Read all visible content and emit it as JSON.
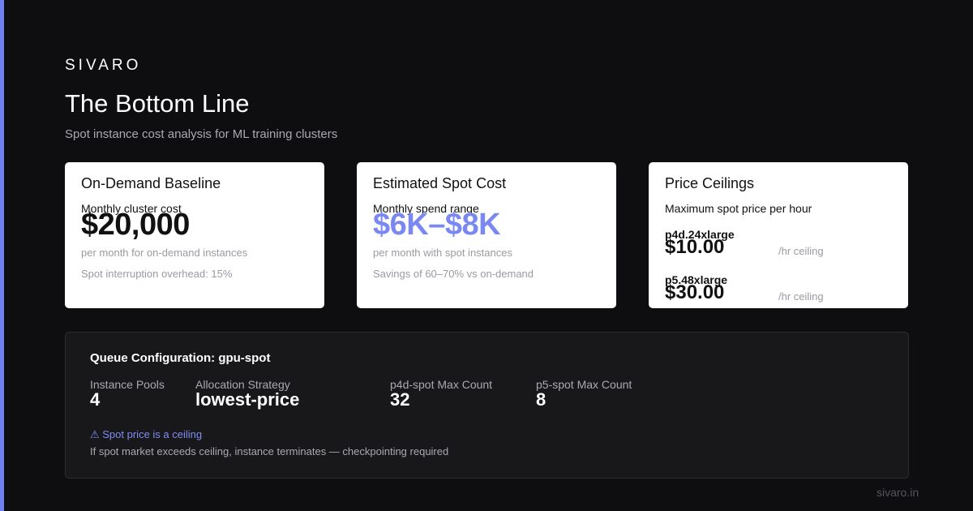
{
  "brand": "SIVARO",
  "header": {
    "title": "The Bottom Line",
    "subtitle": "Spot instance cost analysis for ML training clusters"
  },
  "cards": {
    "on_demand": {
      "title": "On-Demand Baseline",
      "label": "Monthly cluster cost",
      "value": "$20,000",
      "note": "per month for on-demand instances",
      "note2": "Spot interruption overhead: 15%"
    },
    "spot": {
      "title": "Estimated Spot Cost",
      "label": "Monthly spend range",
      "value": "$6K–$8K",
      "note": "per month with spot instances",
      "note2": "Savings of 60–70% vs on-demand"
    },
    "ceilings": {
      "title": "Price Ceilings",
      "label": "Maximum spot price per hour",
      "items": [
        {
          "name": "p4d.24xlarge",
          "price": "$10.00",
          "unit": "/hr ceiling"
        },
        {
          "name": "p5.48xlarge",
          "price": "$30.00",
          "unit": "/hr ceiling"
        }
      ]
    }
  },
  "queue": {
    "title": "Queue Configuration: gpu-spot",
    "stats": [
      {
        "label": "Instance Pools",
        "value": "4"
      },
      {
        "label": "Allocation Strategy",
        "value": "lowest-price"
      },
      {
        "label": "p4d-spot Max Count",
        "value": "32"
      },
      {
        "label": "p5-spot Max Count",
        "value": "8"
      }
    ],
    "warning": "⚠ Spot price is a ceiling",
    "warning_detail": "If spot market exceeds ceiling, instance terminates — checkpointing required"
  },
  "footer": {
    "domain": "sivaro.in"
  },
  "colors": {
    "accent": "#7a88f2",
    "background": "#0e0e10",
    "card": "#ffffff",
    "panel": "#18181b"
  }
}
